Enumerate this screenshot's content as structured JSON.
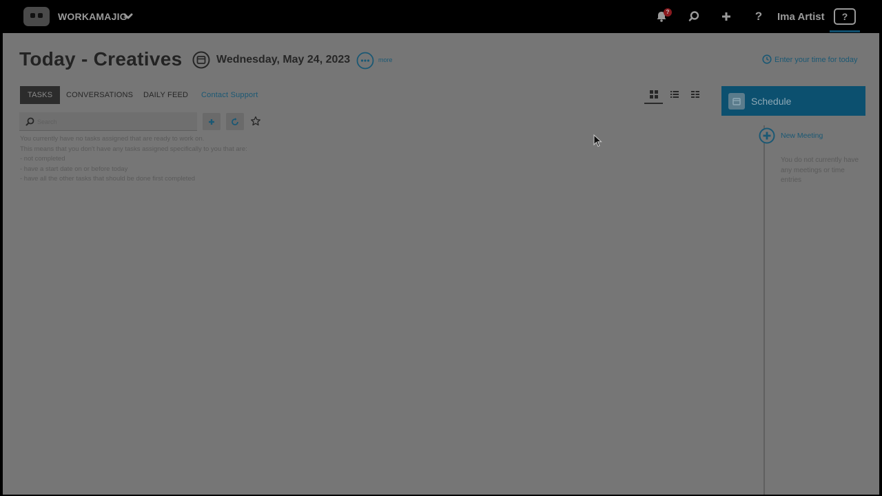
{
  "topbar": {
    "brand": "WORKAMAJIG",
    "notification_count": "?",
    "user_name": "Ima Artist",
    "help_box": "?",
    "help_icon": "?",
    "icons": [
      "bell-icon",
      "search-icon",
      "plus-icon",
      "help-icon"
    ]
  },
  "header": {
    "title": "Today - Creatives",
    "date": "Wednesday, May 24, 2023",
    "more_label": "more",
    "enter_time": "Enter your time for today"
  },
  "tabs": [
    {
      "label": "TASKS",
      "active": true
    },
    {
      "label": "CONVERSATIONS",
      "active": false
    },
    {
      "label": "DAILY FEED",
      "active": false
    },
    {
      "label": "Contact Support",
      "active": false
    }
  ],
  "view_modes": [
    "grid-view-icon",
    "list-view-icon",
    "detail-list-view-icon"
  ],
  "search": {
    "placeholder": "Search",
    "value": ""
  },
  "empty_state": {
    "lines": [
      "You currently have no tasks assigned that are ready to work on.",
      "This means that you don't have any tasks assigned specifically to you that are:",
      "- not completed",
      "- have a start date on or before today",
      "- have all the other tasks that should be done first completed"
    ]
  },
  "schedule": {
    "title": "Schedule",
    "new_meeting": "New Meeting",
    "empty": "You do not currently have any meetings or time entries"
  },
  "colors": {
    "accent": "#0c506f",
    "link": "#1a5874",
    "overlay_background": "#767676",
    "topbar": "#000000",
    "badge": "#8a1a1f"
  }
}
